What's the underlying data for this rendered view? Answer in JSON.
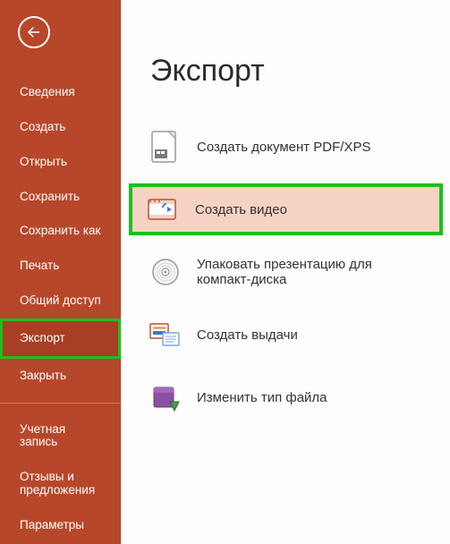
{
  "sidebar": {
    "items": [
      {
        "label": "Сведения"
      },
      {
        "label": "Создать"
      },
      {
        "label": "Открыть"
      },
      {
        "label": "Сохранить"
      },
      {
        "label": "Сохранить как"
      },
      {
        "label": "Печать"
      },
      {
        "label": "Общий доступ"
      },
      {
        "label": "Экспорт"
      },
      {
        "label": "Закрыть"
      }
    ],
    "footer": [
      {
        "label": "Учетная\nзапись"
      },
      {
        "label": "Отзывы и\nпредложения"
      },
      {
        "label": "Параметры"
      }
    ]
  },
  "page": {
    "title": "Экспорт",
    "options": [
      {
        "label": "Создать документ PDF/XPS"
      },
      {
        "label": "Создать видео"
      },
      {
        "label": "Упаковать презентацию для\nкомпакт-диска"
      },
      {
        "label": "Создать выдачи"
      },
      {
        "label": "Изменить тип файла"
      }
    ]
  }
}
